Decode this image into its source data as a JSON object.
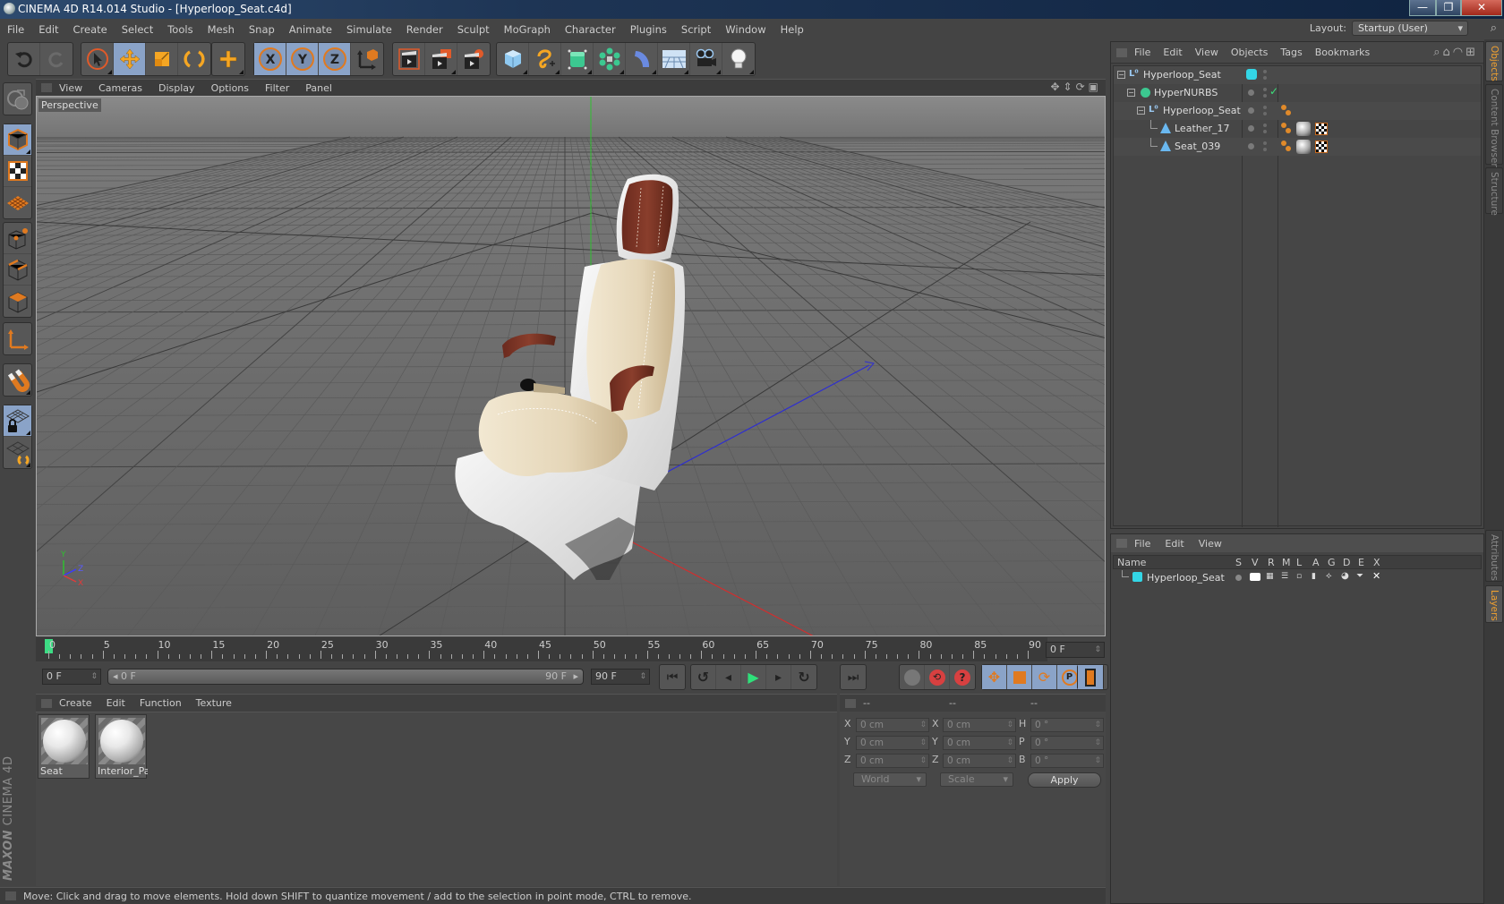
{
  "window": {
    "title": "CINEMA 4D R14.014 Studio - [Hyperloop_Seat.c4d]",
    "buttons": {
      "minimize": "—",
      "restore": "❐",
      "close": "✕"
    }
  },
  "menubar": {
    "items": [
      "File",
      "Edit",
      "Create",
      "Select",
      "Tools",
      "Mesh",
      "Snap",
      "Animate",
      "Simulate",
      "Render",
      "Sculpt",
      "MoGraph",
      "Character",
      "Plugins",
      "Script",
      "Window",
      "Help"
    ],
    "layout_label": "Layout:",
    "layout_value": "Startup (User)"
  },
  "toolbar": {
    "groups": [
      {
        "name": "history",
        "items": [
          {
            "icon": "undo-icon",
            "active": false
          },
          {
            "icon": "redo-icon",
            "active": false
          }
        ]
      },
      {
        "name": "tools",
        "items": [
          {
            "icon": "live-selection-icon",
            "active": false
          },
          {
            "icon": "move-icon",
            "active": true
          },
          {
            "icon": "scale-icon",
            "active": false
          },
          {
            "icon": "rotate-icon",
            "active": false
          }
        ]
      },
      {
        "name": "create",
        "items": [
          {
            "icon": "recent-tool-icon",
            "active": false
          }
        ]
      },
      {
        "name": "axes",
        "items": [
          {
            "icon": "x-axis-lock-icon",
            "active": true,
            "label": "X"
          },
          {
            "icon": "y-axis-lock-icon",
            "active": true,
            "label": "Y"
          },
          {
            "icon": "z-axis-lock-icon",
            "active": true,
            "label": "Z"
          },
          {
            "icon": "coordinate-system-icon",
            "active": false
          }
        ]
      },
      {
        "name": "render",
        "items": [
          {
            "icon": "render-view-icon",
            "active": false
          },
          {
            "icon": "render-picture-viewer-icon",
            "active": false
          },
          {
            "icon": "render-settings-icon",
            "active": false
          }
        ]
      },
      {
        "name": "objects",
        "items": [
          {
            "icon": "cube-primitive-icon",
            "active": false
          },
          {
            "icon": "spline-icon",
            "active": false
          },
          {
            "icon": "nurbs-icon",
            "active": false
          },
          {
            "icon": "mograph-cloner-icon",
            "active": false
          },
          {
            "icon": "deformer-icon",
            "active": false
          },
          {
            "icon": "floor-environment-icon",
            "active": false
          },
          {
            "icon": "camera-icon",
            "active": false
          },
          {
            "icon": "light-icon",
            "active": false
          }
        ]
      }
    ]
  },
  "lefttoolbar": {
    "items": [
      {
        "icon": "make-editable-icon",
        "active": false
      },
      {
        "icon": "model-mode-icon",
        "active": true
      },
      {
        "icon": "texture-mode-icon",
        "active": false
      },
      {
        "icon": "workplane-mode-icon",
        "active": false
      },
      {
        "icon": "points-mode-icon",
        "active": false
      },
      {
        "icon": "edges-mode-icon",
        "active": false
      },
      {
        "icon": "polygons-mode-icon",
        "active": false
      },
      {
        "icon": "axis-mode-icon",
        "active": false
      },
      {
        "icon": "tweak-magnet-icon",
        "active": false
      },
      {
        "icon": "locked-workplane-icon",
        "active": true
      },
      {
        "icon": "planar-workplane-icon",
        "active": false
      }
    ],
    "brand_line1": "MAXON",
    "brand_line2": "CINEMA 4D"
  },
  "viewport": {
    "menus": [
      "View",
      "Cameras",
      "Display",
      "Options",
      "Filter",
      "Panel"
    ],
    "camera_label": "Perspective",
    "nav_icons": [
      "pan-icon",
      "dolly-icon",
      "orbit-icon",
      "toggle-layout-icon"
    ],
    "axis_labels": {
      "y": "Y",
      "z": "Z",
      "x": "X"
    },
    "colors": {
      "seat_cream": "#e8dcc2",
      "leather_brown": "#7a3426",
      "shell_white": "#e8e8e8",
      "y_axis": "#2fbf2f",
      "z_axis": "#2f2fcf",
      "x_axis": "#cf2f2f"
    }
  },
  "timeline": {
    "ticks": [
      0,
      5,
      10,
      15,
      20,
      25,
      30,
      35,
      40,
      45,
      50,
      55,
      60,
      65,
      70,
      75,
      80,
      85,
      90
    ],
    "current_frame_display": "0 F",
    "start_field": "0 F",
    "range_start": "0 F",
    "range_end": "90 F",
    "end_field": "90 F",
    "playhead_frame": 0,
    "max_frame": 90
  },
  "playback": {
    "buttons": [
      "go-to-start-icon",
      "go-to-previous-key-icon",
      "previous-frame-icon",
      "play-forward-icon",
      "next-frame-icon",
      "go-to-next-key-icon",
      "go-to-end-icon"
    ],
    "record": [
      "autokeying-icon",
      "record-active-objects-icon",
      "keyframe-selection-help-icon"
    ],
    "key_tracks": [
      {
        "icon": "position-track-icon",
        "active": true
      },
      {
        "icon": "scale-track-icon",
        "active": true
      },
      {
        "icon": "rotation-track-icon",
        "active": true
      },
      {
        "icon": "parameter-track-icon",
        "active": true,
        "label": "P"
      },
      {
        "icon": "point-level-animation-icon",
        "active": false
      }
    ],
    "timeline_icon": "timeline-window-icon"
  },
  "materials": {
    "menus": [
      "Create",
      "Edit",
      "Function",
      "Texture"
    ],
    "items": [
      {
        "name": "Seat"
      },
      {
        "name": "Interior_Pa"
      }
    ]
  },
  "coordinates": {
    "headers": [
      "--",
      "--",
      "--"
    ],
    "rows": [
      {
        "l1": "X",
        "v1": "0 cm",
        "l2": "X",
        "v2": "0 cm",
        "l3": "H",
        "v3": "0 °"
      },
      {
        "l1": "Y",
        "v1": "0 cm",
        "l2": "Y",
        "v2": "0 cm",
        "l3": "P",
        "v3": "0 °"
      },
      {
        "l1": "Z",
        "v1": "0 cm",
        "l2": "Z",
        "v2": "0 cm",
        "l3": "B",
        "v3": "0 °"
      }
    ],
    "space_dropdown": "World",
    "mode_dropdown": "Scale",
    "apply_label": "Apply"
  },
  "status": {
    "text": "Move: Click and drag to move elements. Hold down SHIFT to quantize movement / add to the selection in point mode, CTRL to remove."
  },
  "objects": {
    "menus": [
      "File",
      "Edit",
      "View",
      "Objects",
      "Tags",
      "Bookmarks"
    ],
    "tools": [
      "search-icon",
      "home-icon",
      "eye-icon",
      "new-window-icon"
    ],
    "tree": [
      {
        "name": "Hyperloop_Seat",
        "depth": 0,
        "type": "null",
        "expander": "−",
        "layer_color": "#33d6e6",
        "tags": []
      },
      {
        "name": "HyperNURBS",
        "depth": 1,
        "type": "hypernurbs",
        "expander": "−",
        "enabled_check": "✓",
        "tags": []
      },
      {
        "name": "Hyperloop_Seat",
        "depth": 2,
        "type": "null",
        "expander": "−",
        "tags": [
          "phong"
        ]
      },
      {
        "name": "Leather_17",
        "depth": 3,
        "type": "polygon",
        "tags": [
          "phong",
          "material",
          "uvw"
        ]
      },
      {
        "name": "Seat_039",
        "depth": 3,
        "type": "polygon",
        "tags": [
          "phong",
          "material",
          "uvw"
        ]
      }
    ]
  },
  "layers": {
    "menus": [
      "File",
      "Edit",
      "View"
    ],
    "columns": [
      "Name",
      "S",
      "V",
      "R",
      "M",
      "L",
      "A",
      "G",
      "D",
      "E",
      "X"
    ],
    "rows": [
      {
        "name": "Hyperloop_Seat",
        "color": "#33d6e6"
      }
    ]
  },
  "right_tabs": {
    "top": [
      {
        "label": "Objects",
        "active": true
      },
      {
        "label": "Content Browser",
        "active": false
      },
      {
        "label": "Structure",
        "active": false
      }
    ],
    "bottom": [
      {
        "label": "Attributes",
        "active": false
      },
      {
        "label": "Layers",
        "active": true
      }
    ]
  }
}
